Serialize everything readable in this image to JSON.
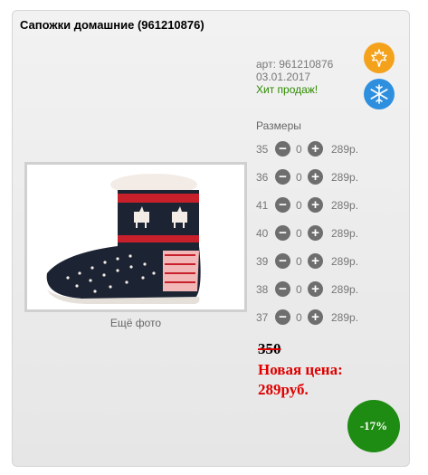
{
  "product": {
    "title": "Сапожки домашние (961210876)",
    "article": "арт: 961210876",
    "date": "03.01.2017",
    "hit_label": "Хит продаж!",
    "more_photo": "Ещё фото"
  },
  "badges": {
    "autumn_icon": "maple-leaf-icon",
    "winter_icon": "snowflake-icon",
    "autumn_color": "#f4a21c",
    "winter_color": "#2f8fdf"
  },
  "sizes": {
    "heading": "Размеры",
    "rows": [
      {
        "size": "35",
        "qty": "0",
        "price": "289р."
      },
      {
        "size": "36",
        "qty": "0",
        "price": "289р."
      },
      {
        "size": "41",
        "qty": "0",
        "price": "289р."
      },
      {
        "size": "40",
        "qty": "0",
        "price": "289р."
      },
      {
        "size": "39",
        "qty": "0",
        "price": "289р."
      },
      {
        "size": "38",
        "qty": "0",
        "price": "289р."
      },
      {
        "size": "37",
        "qty": "0",
        "price": "289р."
      }
    ]
  },
  "pricing": {
    "old_price": "350",
    "new_price_label": "Новая цена:",
    "new_price": "289руб.",
    "discount": "-17%",
    "discount_color": "#1e8c12",
    "new_price_color": "#e00000"
  }
}
